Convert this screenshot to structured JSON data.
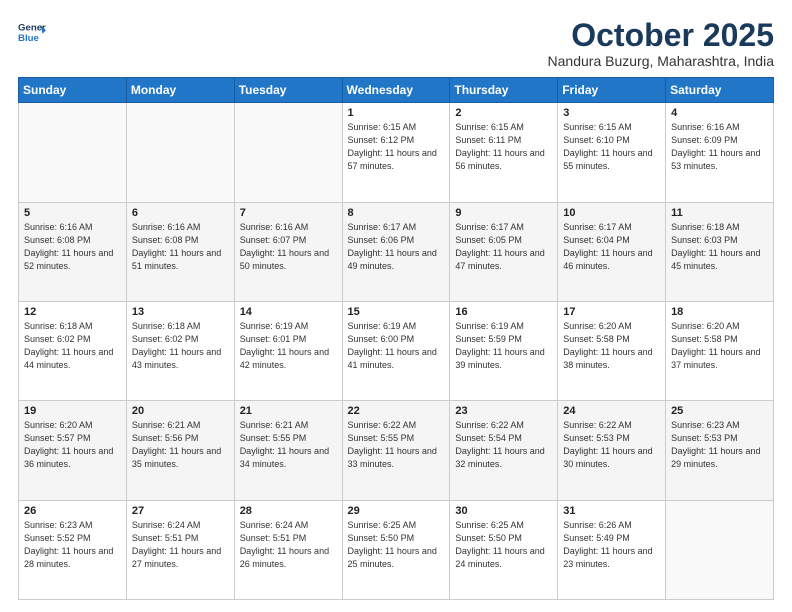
{
  "header": {
    "logo_line1": "General",
    "logo_line2": "Blue",
    "title": "October 2025",
    "subtitle": "Nandura Buzurg, Maharashtra, India"
  },
  "weekdays": [
    "Sunday",
    "Monday",
    "Tuesday",
    "Wednesday",
    "Thursday",
    "Friday",
    "Saturday"
  ],
  "weeks": [
    [
      {
        "day": "",
        "info": ""
      },
      {
        "day": "",
        "info": ""
      },
      {
        "day": "",
        "info": ""
      },
      {
        "day": "1",
        "info": "Sunrise: 6:15 AM\nSunset: 6:12 PM\nDaylight: 11 hours\nand 57 minutes."
      },
      {
        "day": "2",
        "info": "Sunrise: 6:15 AM\nSunset: 6:11 PM\nDaylight: 11 hours\nand 56 minutes."
      },
      {
        "day": "3",
        "info": "Sunrise: 6:15 AM\nSunset: 6:10 PM\nDaylight: 11 hours\nand 55 minutes."
      },
      {
        "day": "4",
        "info": "Sunrise: 6:16 AM\nSunset: 6:09 PM\nDaylight: 11 hours\nand 53 minutes."
      }
    ],
    [
      {
        "day": "5",
        "info": "Sunrise: 6:16 AM\nSunset: 6:08 PM\nDaylight: 11 hours\nand 52 minutes."
      },
      {
        "day": "6",
        "info": "Sunrise: 6:16 AM\nSunset: 6:08 PM\nDaylight: 11 hours\nand 51 minutes."
      },
      {
        "day": "7",
        "info": "Sunrise: 6:16 AM\nSunset: 6:07 PM\nDaylight: 11 hours\nand 50 minutes."
      },
      {
        "day": "8",
        "info": "Sunrise: 6:17 AM\nSunset: 6:06 PM\nDaylight: 11 hours\nand 49 minutes."
      },
      {
        "day": "9",
        "info": "Sunrise: 6:17 AM\nSunset: 6:05 PM\nDaylight: 11 hours\nand 47 minutes."
      },
      {
        "day": "10",
        "info": "Sunrise: 6:17 AM\nSunset: 6:04 PM\nDaylight: 11 hours\nand 46 minutes."
      },
      {
        "day": "11",
        "info": "Sunrise: 6:18 AM\nSunset: 6:03 PM\nDaylight: 11 hours\nand 45 minutes."
      }
    ],
    [
      {
        "day": "12",
        "info": "Sunrise: 6:18 AM\nSunset: 6:02 PM\nDaylight: 11 hours\nand 44 minutes."
      },
      {
        "day": "13",
        "info": "Sunrise: 6:18 AM\nSunset: 6:02 PM\nDaylight: 11 hours\nand 43 minutes."
      },
      {
        "day": "14",
        "info": "Sunrise: 6:19 AM\nSunset: 6:01 PM\nDaylight: 11 hours\nand 42 minutes."
      },
      {
        "day": "15",
        "info": "Sunrise: 6:19 AM\nSunset: 6:00 PM\nDaylight: 11 hours\nand 41 minutes."
      },
      {
        "day": "16",
        "info": "Sunrise: 6:19 AM\nSunset: 5:59 PM\nDaylight: 11 hours\nand 39 minutes."
      },
      {
        "day": "17",
        "info": "Sunrise: 6:20 AM\nSunset: 5:58 PM\nDaylight: 11 hours\nand 38 minutes."
      },
      {
        "day": "18",
        "info": "Sunrise: 6:20 AM\nSunset: 5:58 PM\nDaylight: 11 hours\nand 37 minutes."
      }
    ],
    [
      {
        "day": "19",
        "info": "Sunrise: 6:20 AM\nSunset: 5:57 PM\nDaylight: 11 hours\nand 36 minutes."
      },
      {
        "day": "20",
        "info": "Sunrise: 6:21 AM\nSunset: 5:56 PM\nDaylight: 11 hours\nand 35 minutes."
      },
      {
        "day": "21",
        "info": "Sunrise: 6:21 AM\nSunset: 5:55 PM\nDaylight: 11 hours\nand 34 minutes."
      },
      {
        "day": "22",
        "info": "Sunrise: 6:22 AM\nSunset: 5:55 PM\nDaylight: 11 hours\nand 33 minutes."
      },
      {
        "day": "23",
        "info": "Sunrise: 6:22 AM\nSunset: 5:54 PM\nDaylight: 11 hours\nand 32 minutes."
      },
      {
        "day": "24",
        "info": "Sunrise: 6:22 AM\nSunset: 5:53 PM\nDaylight: 11 hours\nand 30 minutes."
      },
      {
        "day": "25",
        "info": "Sunrise: 6:23 AM\nSunset: 5:53 PM\nDaylight: 11 hours\nand 29 minutes."
      }
    ],
    [
      {
        "day": "26",
        "info": "Sunrise: 6:23 AM\nSunset: 5:52 PM\nDaylight: 11 hours\nand 28 minutes."
      },
      {
        "day": "27",
        "info": "Sunrise: 6:24 AM\nSunset: 5:51 PM\nDaylight: 11 hours\nand 27 minutes."
      },
      {
        "day": "28",
        "info": "Sunrise: 6:24 AM\nSunset: 5:51 PM\nDaylight: 11 hours\nand 26 minutes."
      },
      {
        "day": "29",
        "info": "Sunrise: 6:25 AM\nSunset: 5:50 PM\nDaylight: 11 hours\nand 25 minutes."
      },
      {
        "day": "30",
        "info": "Sunrise: 6:25 AM\nSunset: 5:50 PM\nDaylight: 11 hours\nand 24 minutes."
      },
      {
        "day": "31",
        "info": "Sunrise: 6:26 AM\nSunset: 5:49 PM\nDaylight: 11 hours\nand 23 minutes."
      },
      {
        "day": "",
        "info": ""
      }
    ]
  ]
}
